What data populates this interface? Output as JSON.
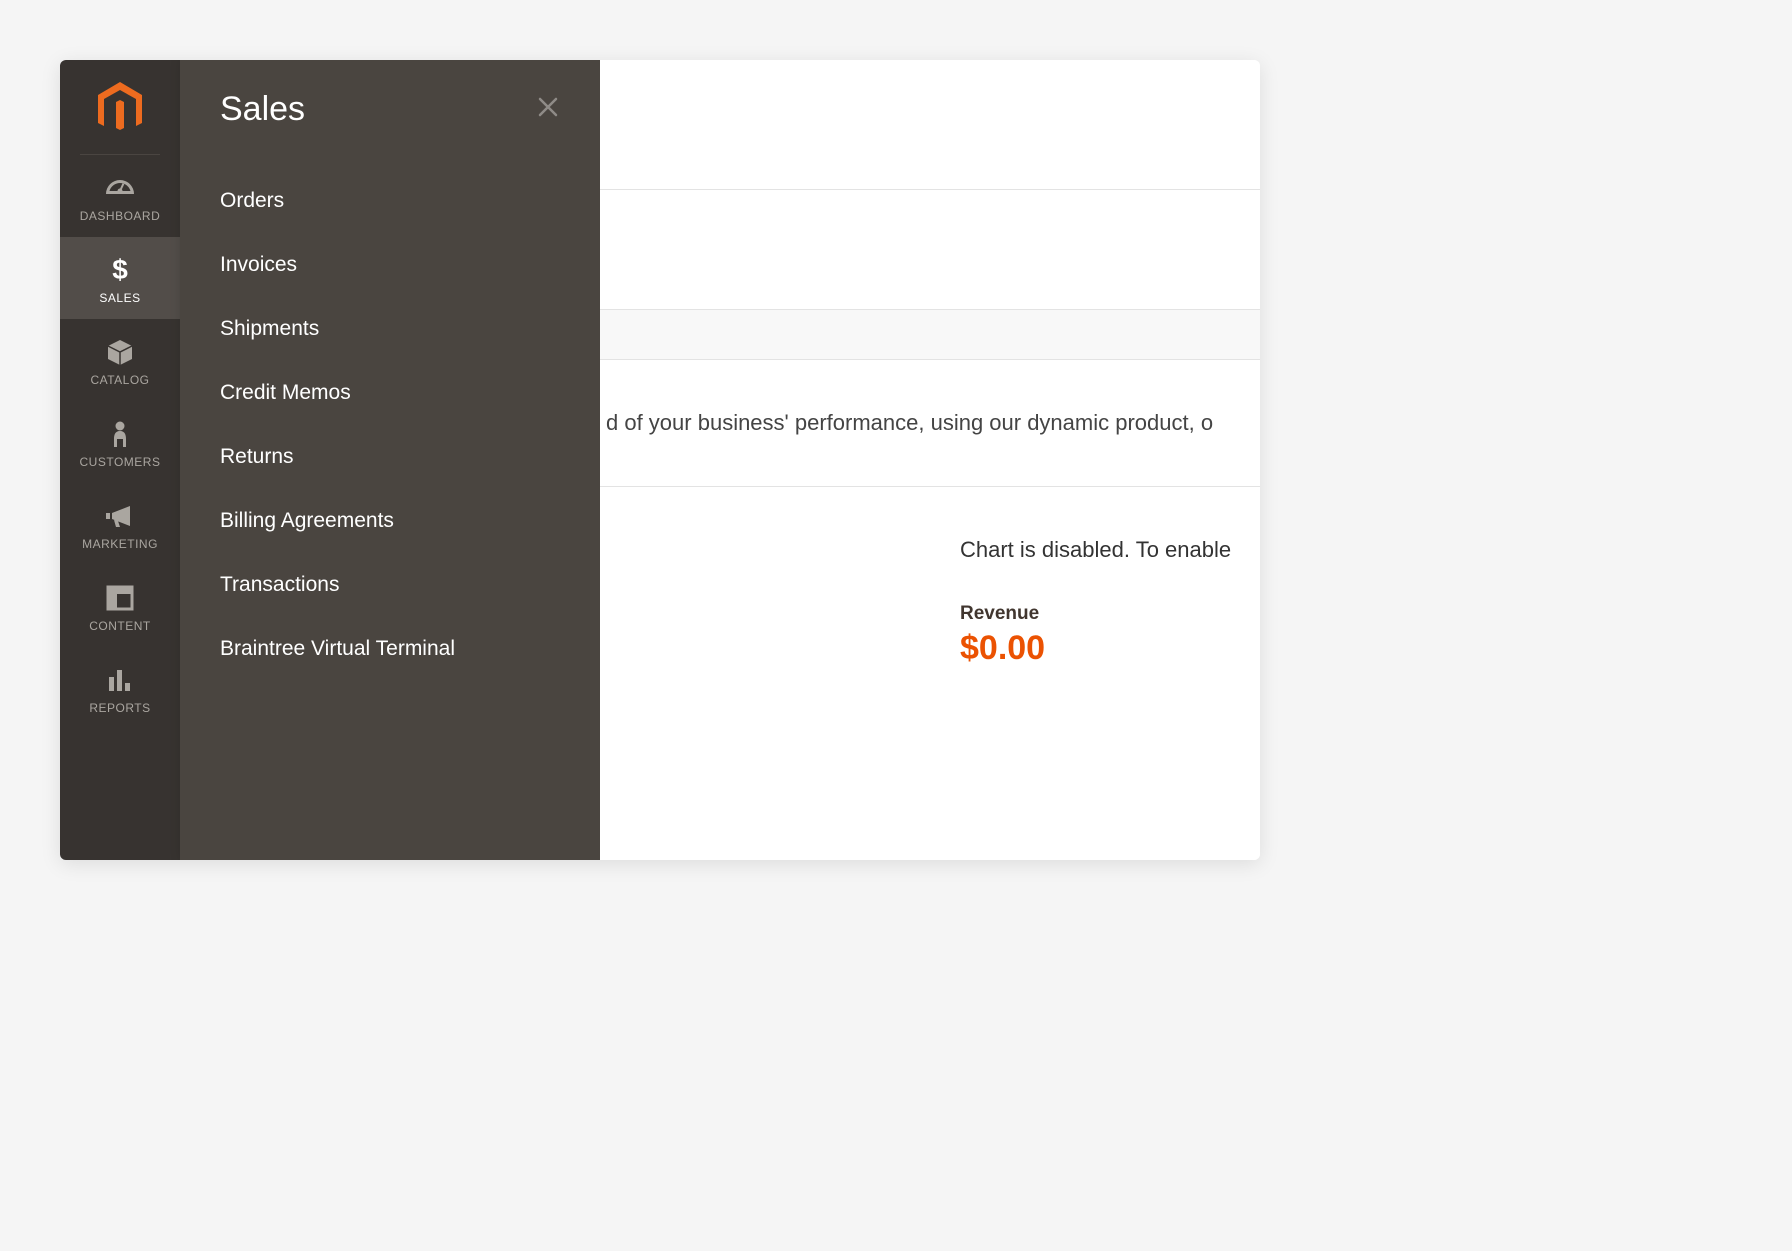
{
  "sidebar": {
    "items": [
      {
        "label": "DASHBOARD"
      },
      {
        "label": "SALES"
      },
      {
        "label": "CATALOG"
      },
      {
        "label": "CUSTOMERS"
      },
      {
        "label": "MARKETING"
      },
      {
        "label": "CONTENT"
      },
      {
        "label": "REPORTS"
      }
    ]
  },
  "flyout": {
    "title": "Sales",
    "items": [
      "Orders",
      "Invoices",
      "Shipments",
      "Credit Memos",
      "Returns",
      "Billing Agreements",
      "Transactions",
      "Braintree Virtual Terminal"
    ]
  },
  "main": {
    "performance_text": "d of your business' performance, using our dynamic product, o",
    "chart_disabled_text": "Chart is disabled. To enable",
    "revenue_label": "Revenue",
    "revenue_value": "$0.00"
  }
}
